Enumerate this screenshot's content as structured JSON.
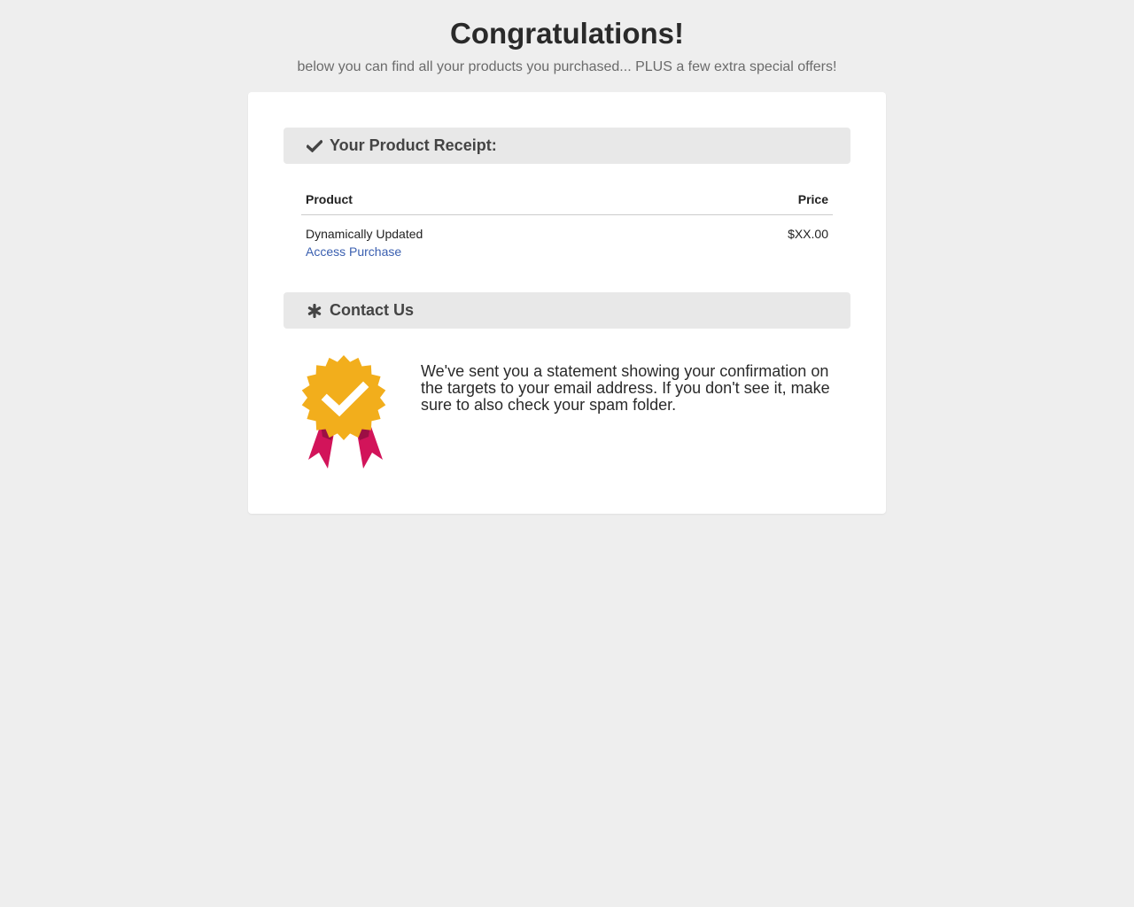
{
  "header": {
    "title": "Congratulations!",
    "subtitle": "below you can find all your products you purchased... PLUS a few extra special offers!"
  },
  "receipt": {
    "icon": "check-icon",
    "title": "Your Product Receipt:",
    "columns": {
      "product": "Product",
      "price": "Price"
    },
    "rows": [
      {
        "product": "Dynamically Updated",
        "link": "Access Purchase",
        "price": "$XX.00"
      }
    ]
  },
  "contact": {
    "icon": "asterisk-icon",
    "title": "Contact Us",
    "badge_icon": "award-badge-icon",
    "message": "We've sent you a statement showing your confirmation on the targets to your email address. If you don't see it, make sure to also check your spam folder."
  },
  "colors": {
    "background": "#eeeeee",
    "card": "#ffffff",
    "section_header": "#e8e8e8",
    "link": "#3a5fb0",
    "badge_gold": "#f2ae1c",
    "ribbon": "#d2145a"
  }
}
